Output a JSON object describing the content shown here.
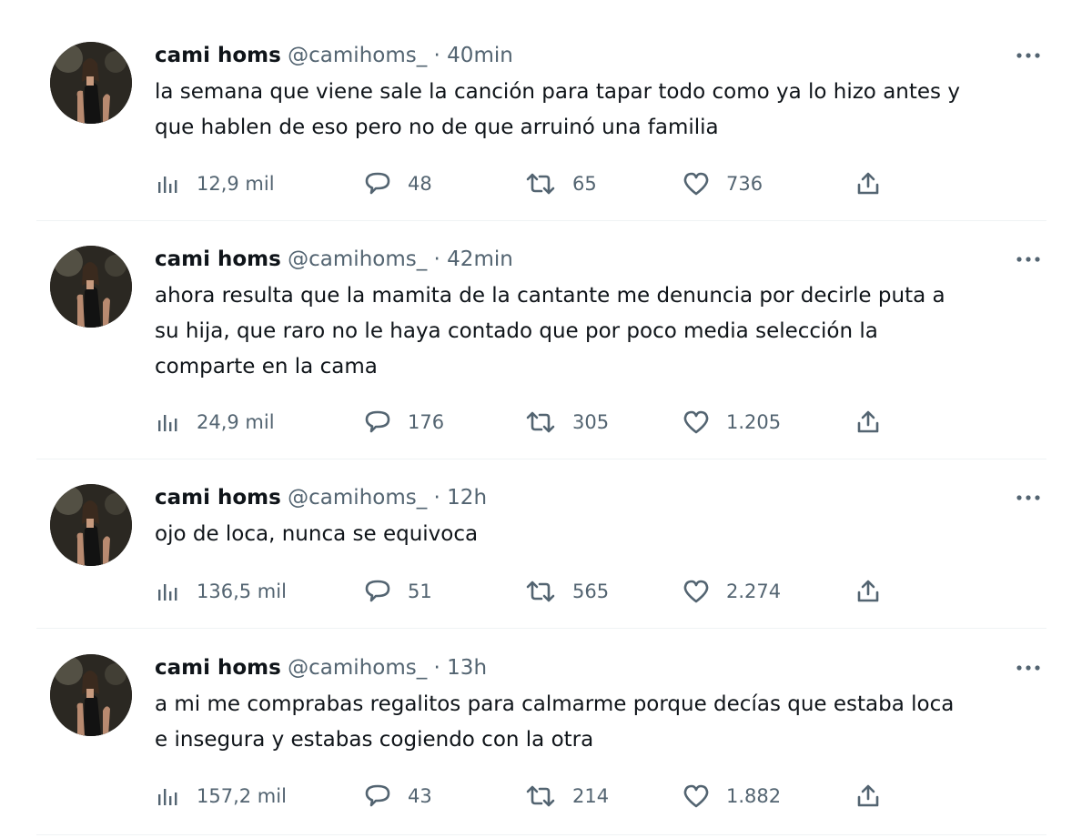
{
  "tweets": [
    {
      "name": "cami homs",
      "handle": "@camihoms_",
      "separator": "·",
      "time": "40min",
      "text_lines": [
        "la semana que viene sale la canción para tapar todo como ya lo hizo antes y",
        "que hablen de eso pero no de que arruinó una familia"
      ],
      "views": "12,9 mil",
      "replies": "48",
      "retweets": "65",
      "likes": "736"
    },
    {
      "name": "cami homs",
      "handle": "@camihoms_",
      "separator": "·",
      "time": "42min",
      "text_lines": [
        "ahora resulta que la mamita de la cantante me denuncia por decirle puta a",
        "su hija, que raro no le haya contado que por poco media selección la",
        "comparte en la cama"
      ],
      "views": "24,9 mil",
      "replies": "176",
      "retweets": "305",
      "likes": "1.205"
    },
    {
      "name": "cami homs",
      "handle": "@camihoms_",
      "separator": "·",
      "time": "12h",
      "text_lines": [
        "ojo de loca, nunca se equivoca"
      ],
      "views": "136,5 mil",
      "replies": "51",
      "retweets": "565",
      "likes": "2.274"
    },
    {
      "name": "cami homs",
      "handle": "@camihoms_",
      "separator": "·",
      "time": "13h",
      "text_lines": [
        "a mi me comprabas regalitos para calmarme porque decías que estaba loca",
        "e insegura y estabas cogiendo con la otra"
      ],
      "views": "157,2 mil",
      "replies": "43",
      "retweets": "214",
      "likes": "1.882"
    }
  ],
  "icons": {
    "views": "views-icon",
    "reply": "reply-icon",
    "retweet": "retweet-icon",
    "like": "like-icon",
    "share": "share-icon",
    "more": "more-icon"
  },
  "colors": {
    "text": "#0f1419",
    "secondary": "#536471",
    "divider": "#eff3f4"
  }
}
